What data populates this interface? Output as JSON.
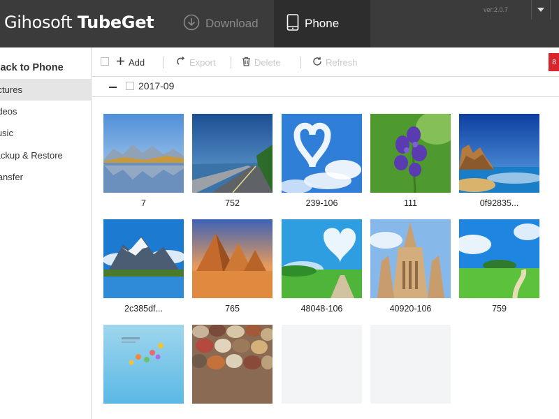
{
  "app": {
    "brand_light": "Gihosoft ",
    "brand_bold": "TubeGet",
    "version": "ver:2.0.7"
  },
  "nav": {
    "download_label": "Download",
    "phone_label": "Phone",
    "active": "Phone"
  },
  "sidebar": {
    "back_label": "Back to Phone",
    "items": [
      {
        "label": "Pictures",
        "active": true
      },
      {
        "label": "Videos",
        "active": false
      },
      {
        "label": "Music",
        "active": false
      },
      {
        "label": "Backup & Restore",
        "active": false
      },
      {
        "label": "Transfer",
        "active": false
      }
    ]
  },
  "toolbar": {
    "add_label": "Add",
    "export_label": "Export",
    "delete_label": "Delete",
    "refresh_label": "Refresh",
    "red_button_label": "8"
  },
  "group": {
    "label": "2017-09"
  },
  "photos": [
    {
      "name": "7"
    },
    {
      "name": "752"
    },
    {
      "name": "239-106"
    },
    {
      "name": "111"
    },
    {
      "name": "0f92835..."
    },
    {
      "name": "2c385df..."
    },
    {
      "name": "765"
    },
    {
      "name": "48048-106"
    },
    {
      "name": "40920-106"
    },
    {
      "name": "759"
    },
    {
      "name": ""
    },
    {
      "name": ""
    },
    {
      "name": ""
    },
    {
      "name": ""
    }
  ],
  "colors": {
    "titlebar": "#3b3b3b",
    "active_tab": "#2d2d2d",
    "sidebar_active": "#e5e5e5",
    "accent_red": "#d9262b"
  }
}
